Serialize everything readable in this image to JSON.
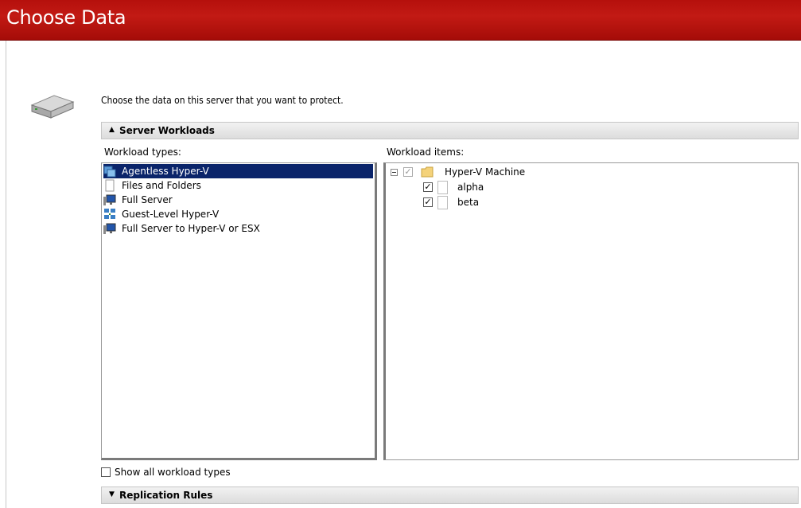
{
  "header": {
    "title": "Choose Data"
  },
  "intro": {
    "text": "Choose the data on this server that you want to protect."
  },
  "sections": {
    "server_workloads": {
      "label": "Server Workloads",
      "state": "expanded"
    },
    "replication_rules": {
      "label": "Replication Rules",
      "state": "collapsed"
    }
  },
  "workload_types": {
    "label": "Workload types:",
    "selected_index": 0,
    "items": [
      {
        "label": "Agentless Hyper-V",
        "icon": "hyperv-host-icon"
      },
      {
        "label": "Files and Folders",
        "icon": "document-icon"
      },
      {
        "label": "Full Server",
        "icon": "server-monitor-icon"
      },
      {
        "label": "Guest-Level Hyper-V",
        "icon": "network-hyperv-icon"
      },
      {
        "label": "Full Server to Hyper-V or ESX",
        "icon": "server-monitor-icon"
      }
    ]
  },
  "workload_items": {
    "label": "Workload items:",
    "root": {
      "label": "Hyper-V Machine",
      "expanded": true,
      "checked": "indeterminate",
      "icon": "folder-icon"
    },
    "children": [
      {
        "label": "alpha",
        "checked": true,
        "icon": "document-icon"
      },
      {
        "label": "beta",
        "checked": true,
        "icon": "document-icon"
      }
    ]
  },
  "show_all": {
    "label": "Show all workload types",
    "checked": false
  },
  "colors": {
    "header_red": "#b5100c",
    "selection_blue": "#0a246a"
  }
}
